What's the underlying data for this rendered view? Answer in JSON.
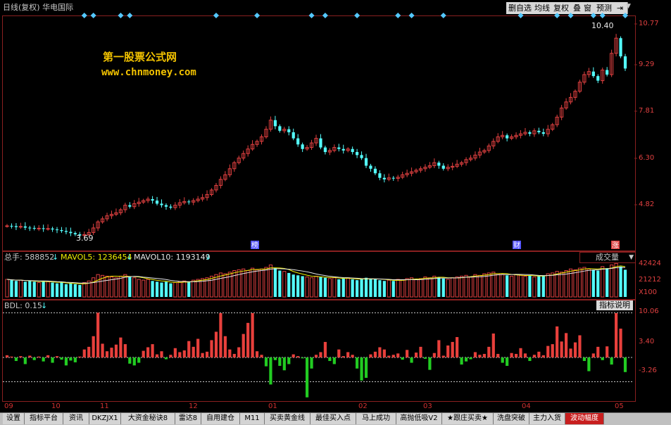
{
  "title": "日线(复权) 华电国际",
  "watermark": {
    "line1": "第一股票公式网",
    "line2": "www.chnmoney.com"
  },
  "toolbar": [
    "删自选",
    "均线",
    "复权",
    "叠",
    "窗",
    "预测"
  ],
  "toolbar_icons": [
    "collapse-arrow-icon",
    "dropdown-arrow-icon"
  ],
  "price_axis": [
    "10.77",
    "9.29",
    "7.81",
    "6.30",
    "4.82"
  ],
  "price_annotations": {
    "high": "10.40",
    "low": "3.69"
  },
  "event_markers": [
    "榜",
    "财",
    "涨"
  ],
  "volume_panel": {
    "total_label": "总手: 588852",
    "mavol5_label": "MAVOL5: 1236454",
    "mavol10_label": "MAVOL10: 1193149",
    "selector": "成交量",
    "axis": [
      "42424",
      "21212",
      "X100"
    ]
  },
  "indicator_panel": {
    "label": "BDL: 0.15",
    "help_button": "指标说明",
    "axis": [
      "10.06",
      "3.40",
      "-3.26"
    ]
  },
  "date_axis": [
    "09",
    "10",
    "11",
    "12",
    "01",
    "02",
    "03",
    "04",
    "05"
  ],
  "tabs": [
    "设置",
    "指标平台",
    "资讯",
    "DKZJX1",
    "大资金秘诀8",
    "雷达8",
    "自用建仓",
    "M11",
    "买卖黄金线",
    "最佳买入点",
    "马上成功",
    "高抛低吸V2",
    "★跟庄买卖★",
    "洗盘突破",
    "主力入货",
    "波动幅度"
  ],
  "active_tab": "波动幅度",
  "colors": {
    "up": "#e04040",
    "down": "#54ffff",
    "bdl_up": "#e8403c",
    "bdl_down": "#22cc22",
    "marker": "#54c8ff"
  },
  "chart_data": {
    "type": "candlestick",
    "closes": [
      4.02,
      4.01,
      3.98,
      4.0,
      3.96,
      3.95,
      3.93,
      3.94,
      3.92,
      3.93,
      3.9,
      3.88,
      3.85,
      3.82,
      3.78,
      3.74,
      3.7,
      3.73,
      3.8,
      3.95,
      4.15,
      4.25,
      4.35,
      4.4,
      4.45,
      4.55,
      4.7,
      4.65,
      4.75,
      4.8,
      4.85,
      4.9,
      4.85,
      4.75,
      4.7,
      4.65,
      4.62,
      4.7,
      4.78,
      4.82,
      4.8,
      4.85,
      4.9,
      4.95,
      5.05,
      5.2,
      5.35,
      5.55,
      5.7,
      5.9,
      6.1,
      6.25,
      6.4,
      6.55,
      6.7,
      6.8,
      6.95,
      7.2,
      7.5,
      7.3,
      7.15,
      7.2,
      7.1,
      6.9,
      6.7,
      6.55,
      6.6,
      6.75,
      6.9,
      6.6,
      6.45,
      6.5,
      6.6,
      6.55,
      6.5,
      6.55,
      6.45,
      6.35,
      6.25,
      6.0,
      5.9,
      5.75,
      5.6,
      5.55,
      5.6,
      5.58,
      5.62,
      5.7,
      5.75,
      5.8,
      5.85,
      5.9,
      5.95,
      6.0,
      6.1,
      6.0,
      5.9,
      5.95,
      5.98,
      6.05,
      6.1,
      6.2,
      6.25,
      6.35,
      6.45,
      6.5,
      6.65,
      6.8,
      6.95,
      7.0,
      6.9,
      6.95,
      7.0,
      7.05,
      7.1,
      7.05,
      7.15,
      7.1,
      7.05,
      7.2,
      7.35,
      7.6,
      7.9,
      8.1,
      8.25,
      8.45,
      8.75,
      9.0,
      9.1,
      8.95,
      8.8,
      9.15,
      9.0,
      9.7,
      10.2,
      9.6,
      9.2
    ],
    "volumes": [
      22,
      21,
      20,
      21,
      19,
      20,
      19,
      18,
      20,
      19,
      18,
      17,
      18,
      16,
      17,
      16,
      15,
      18,
      20,
      24,
      28,
      27,
      26,
      25,
      24,
      26,
      28,
      25,
      24,
      22,
      21,
      22,
      20,
      19,
      18,
      19,
      17,
      18,
      19,
      20,
      19,
      21,
      22,
      23,
      24,
      26,
      28,
      30,
      29,
      31,
      33,
      34,
      35,
      33,
      36,
      34,
      35,
      37,
      40,
      36,
      33,
      32,
      30,
      28,
      27,
      26,
      25,
      24,
      26,
      25,
      24,
      23,
      24,
      22,
      23,
      24,
      22,
      21,
      22,
      24,
      23,
      22,
      21,
      20,
      21,
      20,
      22,
      21,
      23,
      24,
      22,
      23,
      25,
      24,
      26,
      25,
      23,
      22,
      24,
      25,
      26,
      27,
      25,
      28,
      27,
      29,
      30,
      31,
      29,
      28,
      27,
      26,
      28,
      27,
      26,
      27,
      25,
      26,
      27,
      29,
      30,
      32,
      31,
      33,
      35,
      34,
      36,
      37,
      35,
      34,
      33,
      38,
      36,
      40,
      42,
      38,
      34
    ],
    "bdl": [
      0.5,
      0.2,
      -0.8,
      0.3,
      -1.5,
      0.4,
      -0.6,
      0.2,
      -0.9,
      0.5,
      -1.2,
      0.3,
      -0.5,
      -1.8,
      -0.7,
      -1.1,
      0.2,
      1.8,
      2.4,
      4.8,
      10.1,
      3.1,
      1.4,
      2.2,
      2.9,
      4.5,
      3.0,
      -1.4,
      -1.8,
      -1.2,
      1.5,
      2.3,
      3.0,
      0.7,
      1.4,
      -0.4,
      0.6,
      2.1,
      1.2,
      1.6,
      3.7,
      2.4,
      4.2,
      1.0,
      1.3,
      3.9,
      5.8,
      10.0,
      4.8,
      1.8,
      0.8,
      2.3,
      5.3,
      7.8,
      10.0,
      1.4,
      0.6,
      -2.0,
      -6.1,
      -0.6,
      -1.9,
      -2.9,
      -1.5,
      0.7,
      0.3,
      -0.2,
      -9.0,
      -2.5,
      0.6,
      1.2,
      3.5,
      -0.8,
      -1.5,
      1.8,
      0.3,
      1.2,
      0.6,
      -2.5,
      -5.2,
      -4.6,
      0.7,
      1.3,
      2.3,
      1.8,
      0.4,
      0.6,
      0.9,
      -0.5,
      1.7,
      -1.2,
      1.1,
      2.4,
      -0.3,
      -2.8,
      1.0,
      3.9,
      0.4,
      2.7,
      3.5,
      4.6,
      -1.6,
      -0.9,
      -0.4,
      1.2,
      0.6,
      0.8,
      2.4,
      5.4,
      0.8,
      -1.2,
      -1.9,
      1.0,
      0.8,
      2.1,
      0.9,
      -0.8,
      0.6,
      1.3,
      0.5,
      2.6,
      3.0,
      7.0,
      3.6,
      5.5,
      2.0,
      3.4,
      5.0,
      -0.8,
      -3.1,
      0.9,
      2.4,
      -0.6,
      2.5,
      -1.6,
      10.0,
      6.5,
      -3.3
    ]
  }
}
